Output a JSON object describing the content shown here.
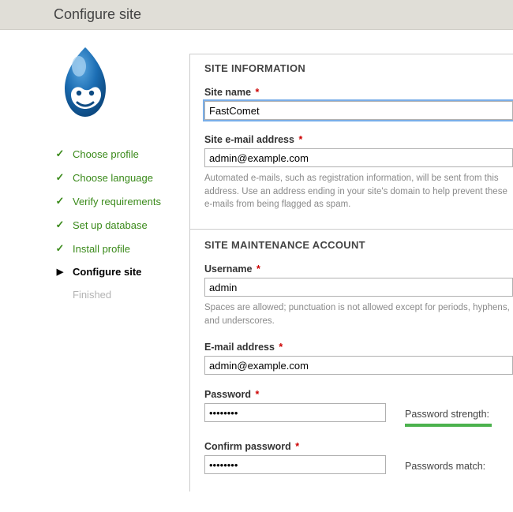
{
  "header": {
    "title": "Configure site"
  },
  "sidebar": {
    "steps": [
      {
        "label": "Choose profile"
      },
      {
        "label": "Choose language"
      },
      {
        "label": "Verify requirements"
      },
      {
        "label": "Set up database"
      },
      {
        "label": "Install profile"
      },
      {
        "label": "Configure site"
      },
      {
        "label": "Finished"
      }
    ]
  },
  "site_info": {
    "section_title": "SITE INFORMATION",
    "site_name_label": "Site name",
    "site_name_value": "FastComet",
    "site_email_label": "Site e-mail address",
    "site_email_value": "admin@example.com",
    "site_email_help": "Automated e-mails, such as registration information, will be sent from this address. Use an address ending in your site's domain to help prevent these e-mails from being flagged as spam."
  },
  "maintenance": {
    "section_title": "SITE MAINTENANCE ACCOUNT",
    "username_label": "Username",
    "username_value": "admin",
    "username_help": "Spaces are allowed; punctuation is not allowed except for periods, hyphens, and underscores.",
    "email_label": "E-mail address",
    "email_value": "admin@example.com",
    "password_label": "Password",
    "password_value": "••••••••",
    "password_strength_label": "Password strength:",
    "confirm_password_label": "Confirm password",
    "confirm_password_value": "••••••••",
    "passwords_match_label": "Passwords match:"
  },
  "required_marker": "*"
}
